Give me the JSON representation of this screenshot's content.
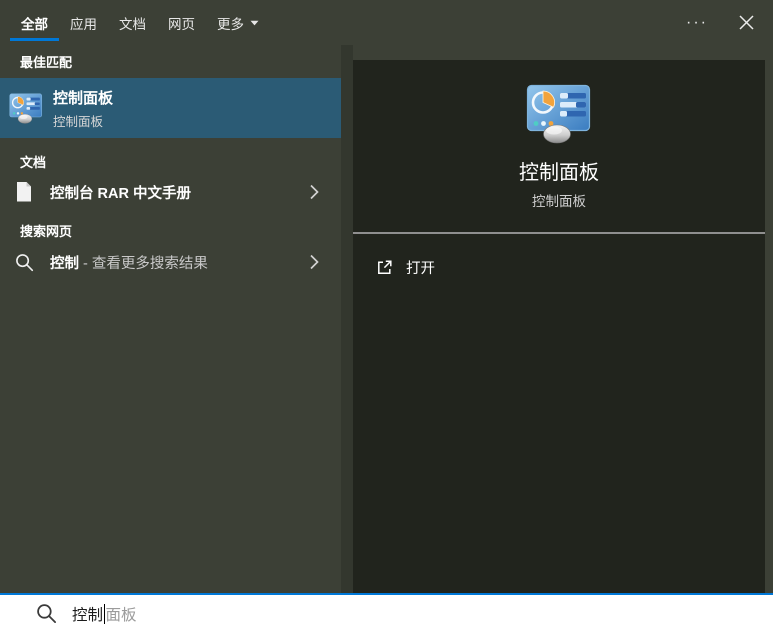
{
  "colors": {
    "accent": "#0078d7",
    "flyout_bg": "#3c4036",
    "strip_bg": "#33372e",
    "card_bg": "#21241d",
    "highlight_bg": "#2b5b75",
    "searchbar_bg": "#ffffff"
  },
  "tabs": {
    "items": [
      {
        "label": "全部",
        "selected": true
      },
      {
        "label": "应用",
        "selected": false
      },
      {
        "label": "文档",
        "selected": false
      },
      {
        "label": "网页",
        "selected": false
      },
      {
        "label": "更多",
        "selected": false,
        "has_dropdown": true
      }
    ]
  },
  "titlebar": {
    "more_options_glyph": "···"
  },
  "sections": {
    "best_match": {
      "header": "最佳匹配",
      "item": {
        "title": "控制面板",
        "subtitle": "控制面板",
        "icon": "control-panel-icon"
      }
    },
    "documents": {
      "header": "文档",
      "item": {
        "title": "控制台 RAR 中文手册",
        "icon": "document-icon"
      }
    },
    "web_search": {
      "header": "搜索网页",
      "item": {
        "query": "控制",
        "suffix": " - 查看更多搜索结果",
        "icon": "search-icon"
      }
    }
  },
  "preview": {
    "title": "控制面板",
    "subtitle": "控制面板",
    "icon": "control-panel-icon",
    "actions": [
      {
        "label": "打开",
        "icon": "open-external-icon"
      }
    ]
  },
  "search": {
    "typed": "控制",
    "suggestion": "面板",
    "icon": "search-icon"
  }
}
